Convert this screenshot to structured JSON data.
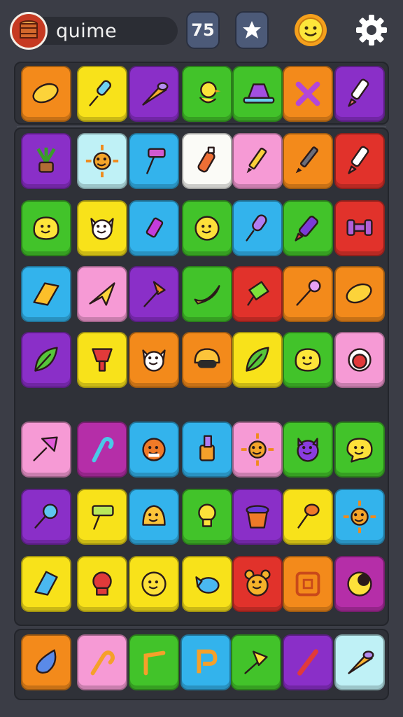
{
  "header": {
    "player_name": "quime",
    "level_label": "75",
    "avatar_icon": "barrel-icon",
    "star_icon": "star-icon",
    "smiley_icon": "sun-face-icon",
    "settings_icon": "gear-icon"
  },
  "colors": {
    "orange": "#f38a1b",
    "yellow": "#f8e21a",
    "purple": "#8a2fc8",
    "green": "#42c32a",
    "sky": "#33b3ec",
    "red": "#e1322b",
    "pink": "#f69ad5",
    "magenta": "#b52ea8",
    "paleblue": "#bff1f6",
    "white": "#fbfbf7"
  },
  "top_row": [
    {
      "icon": "lemon-icon",
      "color": "orange"
    },
    {
      "icon": "ice-pop-icon",
      "color": "yellow"
    },
    {
      "icon": "cone-icon",
      "color": "purple"
    },
    {
      "icon": "duck-icon",
      "color": "green"
    },
    {
      "icon": "hat-icon",
      "color": "green"
    },
    {
      "icon": "cross-icon",
      "color": "orange"
    },
    {
      "icon": "marker-icon",
      "color": "purple"
    }
  ],
  "grid_rows": [
    [
      {
        "icon": "potted-plant-icon",
        "color": "purple"
      },
      {
        "icon": "sun-icon",
        "color": "paleblue"
      },
      {
        "icon": "hammer-icon",
        "color": "sky"
      },
      {
        "icon": "bottle-icon",
        "color": "white"
      },
      {
        "icon": "pencil-icon",
        "color": "pink"
      },
      {
        "icon": "pen-icon",
        "color": "orange"
      },
      {
        "icon": "marker-icon",
        "color": "red"
      }
    ],
    [
      {
        "icon": "blob-face-icon",
        "color": "green"
      },
      {
        "icon": "cat-face-icon",
        "color": "yellow"
      },
      {
        "icon": "lipstick-icon",
        "color": "sky"
      },
      {
        "icon": "smiley-face-icon",
        "color": "green"
      },
      {
        "icon": "microphone-icon",
        "color": "sky"
      },
      {
        "icon": "crayon-icon",
        "color": "green"
      },
      {
        "icon": "dumbbell-icon",
        "color": "red"
      }
    ],
    [
      {
        "icon": "gem-icon",
        "color": "sky"
      },
      {
        "icon": "paper-plane-icon",
        "color": "pink"
      },
      {
        "icon": "shovel-icon",
        "color": "purple"
      },
      {
        "icon": "banana-icon",
        "color": "green"
      },
      {
        "icon": "cup-icon",
        "color": "red"
      },
      {
        "icon": "wand-icon",
        "color": "orange"
      },
      {
        "icon": "lemon-icon",
        "color": "orange"
      }
    ],
    [
      {
        "icon": "leaf-icon",
        "color": "purple"
      },
      {
        "icon": "goblet-icon",
        "color": "yellow"
      },
      {
        "icon": "cat-face-icon",
        "color": "orange"
      },
      {
        "icon": "helmet-icon",
        "color": "orange"
      },
      {
        "icon": "leaf-icon",
        "color": "yellow"
      },
      {
        "icon": "blob-face-icon",
        "color": "green"
      },
      {
        "icon": "robot-face-icon",
        "color": "pink"
      }
    ],
    [
      {
        "icon": "pin-icon",
        "color": "pink"
      },
      {
        "icon": "cane-icon",
        "color": "magenta"
      },
      {
        "icon": "monster-face-icon",
        "color": "sky"
      },
      {
        "icon": "brush-icon",
        "color": "sky"
      },
      {
        "icon": "sun-icon",
        "color": "pink"
      },
      {
        "icon": "devil-face-icon",
        "color": "green"
      },
      {
        "icon": "chat-face-icon",
        "color": "green"
      }
    ],
    [
      {
        "icon": "magnifier-icon",
        "color": "purple"
      },
      {
        "icon": "roller-icon",
        "color": "yellow"
      },
      {
        "icon": "bell-icon",
        "color": "sky"
      },
      {
        "icon": "bulb-icon",
        "color": "green"
      },
      {
        "icon": "pot-icon",
        "color": "purple"
      },
      {
        "icon": "mallet-icon",
        "color": "yellow"
      },
      {
        "icon": "sun-icon",
        "color": "sky"
      }
    ],
    [
      {
        "icon": "diamond-icon",
        "color": "yellow"
      },
      {
        "icon": "badge-icon",
        "color": "yellow"
      },
      {
        "icon": "smiley-face-icon",
        "color": "yellow"
      },
      {
        "icon": "fish-icon",
        "color": "yellow"
      },
      {
        "icon": "bear-face-icon",
        "color": "red"
      },
      {
        "icon": "frame-icon",
        "color": "orange"
      },
      {
        "icon": "moon-icon",
        "color": "magenta"
      }
    ]
  ],
  "tray": [
    {
      "icon": "drop-icon",
      "color": "orange"
    },
    {
      "icon": "hook-icon",
      "color": "pink"
    },
    {
      "icon": "corner-icon",
      "color": "green"
    },
    {
      "icon": "letter-p-icon",
      "color": "sky"
    },
    {
      "icon": "pushpin-icon",
      "color": "green"
    },
    {
      "icon": "stick-icon",
      "color": "purple"
    },
    {
      "icon": "cone-icon",
      "color": "paleblue"
    }
  ]
}
